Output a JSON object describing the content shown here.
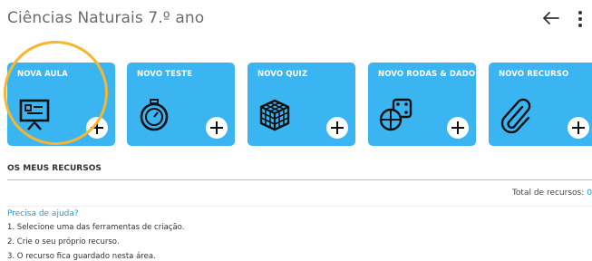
{
  "header": {
    "title": "Ciências Naturais 7.º ano",
    "back_icon": "arrow-left-icon",
    "menu_icon": "more-vert-icon"
  },
  "cards": [
    {
      "label": "NOVA AULA",
      "icon": "presentation-board-icon"
    },
    {
      "label": "NOVO TESTE",
      "icon": "stopwatch-icon"
    },
    {
      "label": "NOVO QUIZ",
      "icon": "cube-puzzle-icon"
    },
    {
      "label": "NOVO RODAS & DADOS",
      "icon": "wheel-dice-icon"
    },
    {
      "label": "NOVO RECURSO",
      "icon": "paperclip-icon"
    }
  ],
  "card_color": "#3bb4f2",
  "highlight_color": "#f5b731",
  "resources": {
    "title": "OS MEUS RECURSOS",
    "total_label": "Total de recursos:",
    "total_value": "0"
  },
  "help": {
    "link": "Precisa de ajuda?",
    "steps": [
      "1. Selecione uma das ferramentas de criação.",
      "2. Crie o seu próprio recurso.",
      "3. O recurso fica guardado nesta área."
    ]
  }
}
